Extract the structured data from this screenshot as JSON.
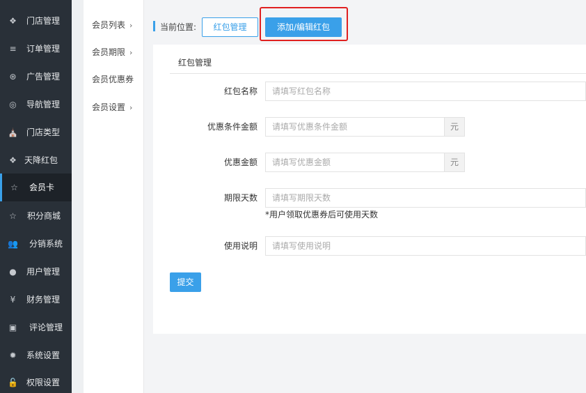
{
  "sidebar": {
    "items": [
      {
        "label": "门店管理",
        "icon": "cubes-icon",
        "glyph": "❖"
      },
      {
        "label": "订单管理",
        "icon": "list-icon",
        "glyph": "≡"
      },
      {
        "label": "广告管理",
        "icon": "lifebuoy-icon",
        "glyph": "⊛"
      },
      {
        "label": "导航管理",
        "icon": "compass-icon",
        "glyph": "◎"
      },
      {
        "label": "门店类型",
        "icon": "bank-icon",
        "glyph": "⛪"
      },
      {
        "label": "天降红包",
        "icon": "cubes-icon",
        "glyph": "❖"
      },
      {
        "label": "会员卡",
        "icon": "star-half-icon",
        "glyph": "☆",
        "active": true
      },
      {
        "label": "积分商城",
        "icon": "star-half-icon",
        "glyph": "☆"
      },
      {
        "label": "分销系统",
        "icon": "users-icon",
        "glyph": "👥"
      },
      {
        "label": "用户管理",
        "icon": "user-icon",
        "glyph": "●"
      },
      {
        "label": "财务管理",
        "icon": "yen-icon",
        "glyph": "¥"
      },
      {
        "label": "评论管理",
        "icon": "money-icon",
        "glyph": "▣"
      },
      {
        "label": "系统设置",
        "icon": "gear-icon",
        "glyph": "✹"
      },
      {
        "label": "权限设置",
        "icon": "lock-icon",
        "glyph": "🔓"
      }
    ]
  },
  "submenu": {
    "items": [
      {
        "label": "会员列表",
        "has_arrow": true
      },
      {
        "label": "会员期限",
        "has_arrow": true
      },
      {
        "label": "会员优惠券",
        "has_arrow": false
      },
      {
        "label": "会员设置",
        "has_arrow": true
      }
    ],
    "arrow": "›"
  },
  "breadcrumb": {
    "label": "当前位置:",
    "link_label": "红包管理",
    "current_label": "添加/编辑红包"
  },
  "form": {
    "title": "红包管理",
    "fields": {
      "name": {
        "label": "红包名称",
        "placeholder": "请填写红包名称"
      },
      "condition": {
        "label": "优惠条件金额",
        "placeholder": "请填写优惠条件金额",
        "unit": "元"
      },
      "amount": {
        "label": "优惠金额",
        "placeholder": "请填写优惠金额",
        "unit": "元"
      },
      "days": {
        "label": "期限天数",
        "placeholder": "请填写期限天数",
        "hint": "*用户领取优惠券后可使用天数"
      },
      "desc": {
        "label": "使用说明",
        "placeholder": "请填写使用说明"
      }
    },
    "submit_label": "提交"
  },
  "colors": {
    "sidebar_bg": "#293038",
    "accent": "#3aa0e9",
    "highlight_border": "#e02020"
  }
}
